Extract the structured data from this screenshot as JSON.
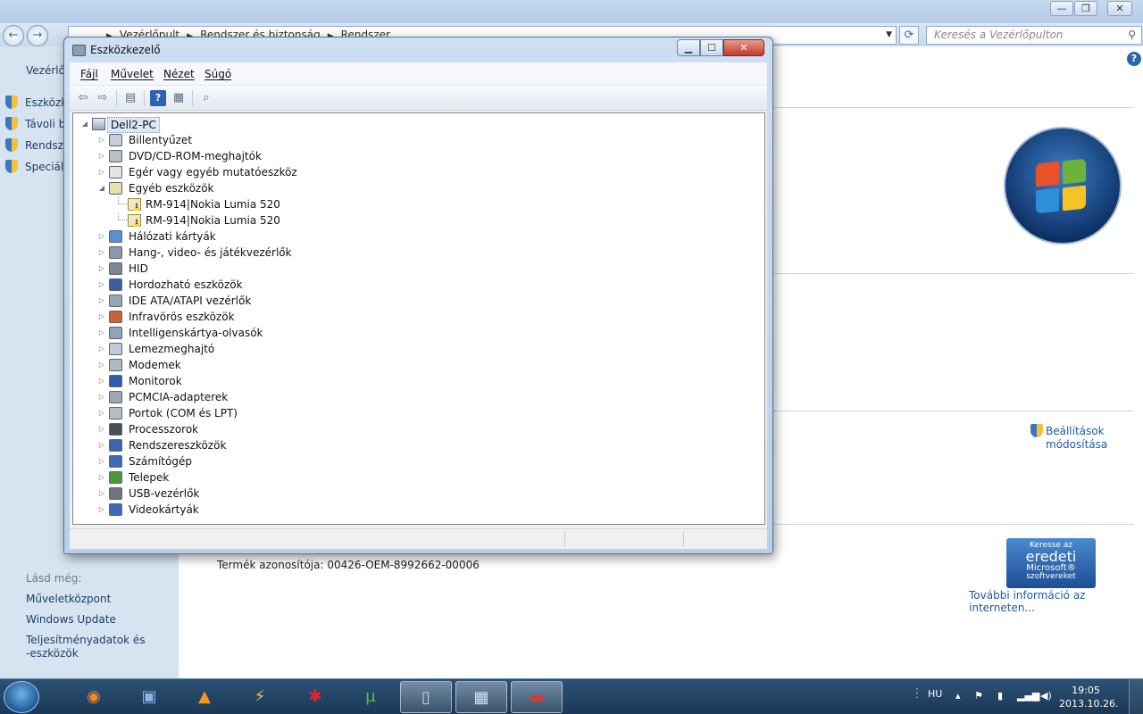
{
  "background_window": {
    "title": "",
    "breadcrumb": [
      "Vezérlőpult",
      "Rendszer és biztonság",
      "Rendszer"
    ],
    "search_placeholder": "Keresés a Vezérlőpulton",
    "sidebar": {
      "home": "Vezérlőp",
      "links": [
        "Eszközk",
        "Távoli b",
        "Rendsze",
        "Speciális"
      ],
      "see_also_label": "Lásd még:",
      "see_also": [
        "Műveletközpont",
        "Windows Update",
        "Teljesítményadatok és",
        "-eszközök"
      ]
    },
    "settings_link": [
      "Beállítások",
      "módosítása"
    ],
    "product_id": "Termék azonosítója: 00426-OEM-8992662-00006",
    "genuine_badge": [
      "Keresse az",
      "eredeti",
      "Microsoft®",
      "szoftvereket"
    ],
    "more_info": "További információ az interneten..."
  },
  "device_manager": {
    "title": "Eszközkezelő",
    "menu": [
      "Fájl",
      "Művelet",
      "Nézet",
      "Súgó"
    ],
    "toolbar": [
      "back-arrow-icon",
      "forward-arrow-icon",
      "show-hide-icon",
      "help-icon",
      "properties-icon",
      "scan-hardware-icon"
    ],
    "tree": {
      "root": "Dell2-PC",
      "categories": [
        {
          "label": "Billentyűzet",
          "icon": "keyboard-icon",
          "expanded": false
        },
        {
          "label": "DVD/CD-ROM-meghajtók",
          "icon": "dvd-drive-icon",
          "expanded": false
        },
        {
          "label": "Egér vagy egyéb mutatóeszköz",
          "icon": "mouse-icon",
          "expanded": false
        },
        {
          "label": "Egyéb eszközök",
          "icon": "unknown-device-icon",
          "expanded": true,
          "children": [
            "RM-914|Nokia Lumia 520",
            "RM-914|Nokia Lumia 520"
          ]
        },
        {
          "label": "Hálózati kártyák",
          "icon": "network-adapter-icon",
          "expanded": false
        },
        {
          "label": "Hang-, video- és játékvezérlők",
          "icon": "speaker-icon",
          "expanded": false
        },
        {
          "label": "HID",
          "icon": "hid-icon",
          "expanded": false
        },
        {
          "label": "Hordozható eszközök",
          "icon": "portable-device-icon",
          "expanded": false
        },
        {
          "label": "IDE ATA/ATAPI vezérlők",
          "icon": "ide-controller-icon",
          "expanded": false
        },
        {
          "label": "Infravörös eszközök",
          "icon": "infrared-icon",
          "expanded": false
        },
        {
          "label": "Intelligenskártya-olvasók",
          "icon": "smartcard-reader-icon",
          "expanded": false
        },
        {
          "label": "Lemezmeghajtó",
          "icon": "disk-drive-icon",
          "expanded": false
        },
        {
          "label": "Modemek",
          "icon": "modem-icon",
          "expanded": false
        },
        {
          "label": "Monitorok",
          "icon": "monitor-icon",
          "expanded": false
        },
        {
          "label": "PCMCIA-adapterek",
          "icon": "pcmcia-icon",
          "expanded": false
        },
        {
          "label": "Portok (COM és LPT)",
          "icon": "port-icon",
          "expanded": false
        },
        {
          "label": "Processzorok",
          "icon": "processor-icon",
          "expanded": false
        },
        {
          "label": "Rendszereszközök",
          "icon": "system-device-icon",
          "expanded": false
        },
        {
          "label": "Számítógép",
          "icon": "computer-icon",
          "expanded": false
        },
        {
          "label": "Telepek",
          "icon": "battery-icon",
          "expanded": false
        },
        {
          "label": "USB-vezérlők",
          "icon": "usb-icon",
          "expanded": false
        },
        {
          "label": "Videokártyák",
          "icon": "display-adapter-icon",
          "expanded": false
        }
      ]
    }
  },
  "taskbar": {
    "apps": [
      {
        "name": "firefox",
        "icon": "firefox-icon",
        "active": false
      },
      {
        "name": "save",
        "icon": "floppy-icon",
        "active": false
      },
      {
        "name": "vlc",
        "icon": "vlc-icon",
        "active": false
      },
      {
        "name": "winamp",
        "icon": "winamp-icon",
        "active": false
      },
      {
        "name": "splat",
        "icon": "splat-icon",
        "active": false
      },
      {
        "name": "utorrent",
        "icon": "utorrent-icon",
        "active": false
      },
      {
        "name": "phone",
        "icon": "phone-icon",
        "active": true
      },
      {
        "name": "control-panel",
        "icon": "control-panel-icon",
        "active": true
      },
      {
        "name": "device-manager",
        "icon": "toolbox-icon",
        "active": true
      }
    ],
    "language": "HU",
    "time": "19:05",
    "date": "2013.10.26."
  },
  "colors": {
    "link": "#1e5aa8",
    "taskbar": "#1b3856",
    "sidebar": "#d6e4f2",
    "close_button": "#c1392b"
  }
}
